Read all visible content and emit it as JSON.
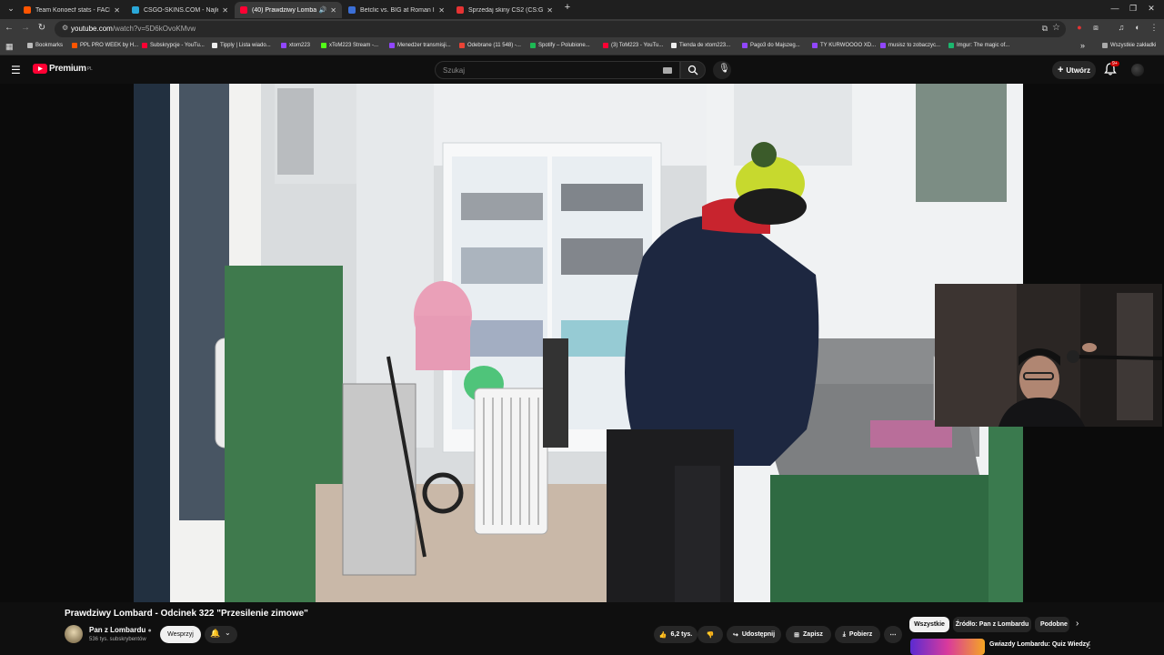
{
  "browser": {
    "tabs": [
      {
        "title": "Team Konoecf stats - FACEIT.co",
        "color": "#ff5500",
        "active": false
      },
      {
        "title": "CSGO-SKINS.COM - Najlepsze",
        "color": "#2aa7d8",
        "active": false
      },
      {
        "title": "(40) Prawdziwy Lombard -",
        "color": "#ff0033",
        "active": true,
        "audio": "🔊"
      },
      {
        "title": "Betclic vs. BIG at Roman Imperi",
        "color": "#3b6fd6",
        "active": false
      },
      {
        "title": "Sprzedaj skiny CS2 (CS:GO) | N",
        "color": "#e53333",
        "active": false
      }
    ],
    "tab_close": "✕",
    "new_tab": "+",
    "url": "youtube.com/watch?v=5D6kOvoKMvw",
    "url_host": "youtube.com",
    "url_path": "/watch?v=5D6kOvoKMvw",
    "bookmarks": [
      {
        "label": "Bookmarks",
        "color": "#bbbbbb"
      },
      {
        "label": "PPL PRO WEEK by H...",
        "color": "#ff5500"
      },
      {
        "label": "Subskrypcje - YouTu...",
        "color": "#ff0033"
      },
      {
        "label": "Tipply | Lista wiado...",
        "color": "#eeeeee"
      },
      {
        "label": "xtom223",
        "color": "#9146ff"
      },
      {
        "label": "xToM223 Stream -...",
        "color": "#53fc18"
      },
      {
        "label": "Menedżer transmisji...",
        "color": "#9146ff"
      },
      {
        "label": "Odebrane (11 548) -...",
        "color": "#ea4335"
      },
      {
        "label": "Spotify – Polubione...",
        "color": "#1db954"
      },
      {
        "label": "(3) ToM223 - YouTu...",
        "color": "#ff0033"
      },
      {
        "label": "Tienda de xtom223...",
        "color": "#eeeeee"
      },
      {
        "label": "Pago3 do Majszeg...",
        "color": "#9146ff"
      },
      {
        "label": "TY KURWOOOO XD...",
        "color": "#9146ff"
      },
      {
        "label": "musisz to zobaczyc...",
        "color": "#9146ff"
      },
      {
        "label": "Imgur: The magic of...",
        "color": "#1bb76e"
      }
    ],
    "bookmarks_more": "»",
    "all_bookmarks": "Wszystkie zakładki"
  },
  "youtube": {
    "logo_text": "Premium",
    "logo_sup": "PL",
    "search_placeholder": "Szukaj",
    "create_label": "Utwórz",
    "notif_count": "9+",
    "video": {
      "title": "Prawdziwy Lombard - Odcinek 322 \"Przesilenie zimowe\"",
      "channel": "Pan z Lombardu",
      "subscribers": "536 tys. subskrybentów",
      "join_label": "Wesprzyj",
      "likes": "6,2 tys.",
      "share_label": "Udostępnij",
      "save_label": "Zapisz",
      "download_label": "Pobierz",
      "more": "⋯"
    },
    "chips": [
      "Wszystkie",
      "Źródło: Pan z Lombardu",
      "Podobne"
    ],
    "recommendation": {
      "title": "Gwiazdy Lombardu: Quiz Wiedzy"
    }
  }
}
